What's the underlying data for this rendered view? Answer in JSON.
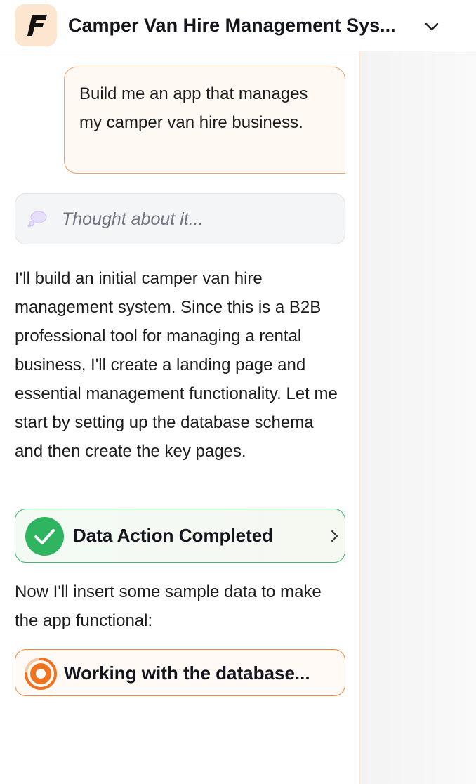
{
  "header": {
    "logo_icon": "brand-logo-icon",
    "title": "Camper Van Hire Management Sys...",
    "chevron_icon": "chevron-down-icon"
  },
  "chat": {
    "user_message": "Build me an app that manages my camper van hire business.",
    "thought": {
      "icon": "thought-bubble-icon",
      "text": "Thought about it..."
    },
    "assistant_message_1": "I'll build an initial camper van hire management system. Since this is a B2B professional tool for managing a rental business, I'll create a landing page and essential management functionality. Let me start by setting up the database schema and then create the key pages.",
    "action_card": {
      "icon": "check-circle-icon",
      "label": "Data Action Completed",
      "chevron_icon": "chevron-right-icon",
      "status_color": "#2fb45f"
    },
    "assistant_message_2": "Now I'll insert some sample data to make the app functional:",
    "working_card": {
      "icon": "spinner-icon",
      "label": "Working with the database...",
      "status_color": "#f0741f"
    }
  },
  "colors": {
    "accent": "#f08a3e",
    "logo_bg": "#fde6cf",
    "success": "#2fb45f"
  }
}
